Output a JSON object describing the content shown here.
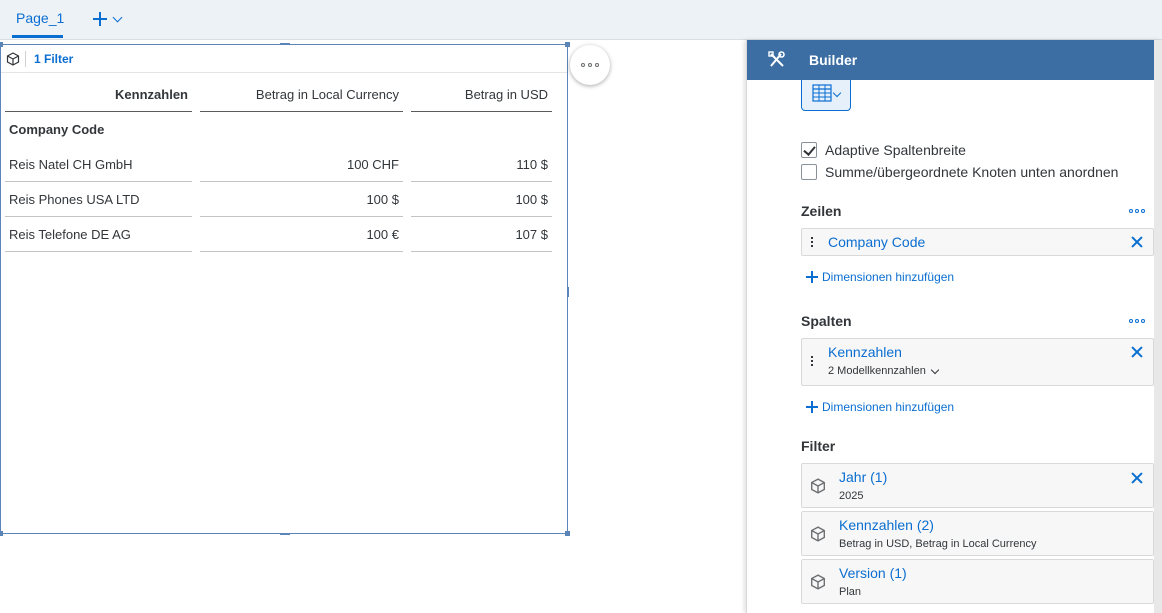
{
  "tabbar": {
    "page_tab": "Page_1"
  },
  "widget": {
    "filter_label": "1 Filter",
    "headers": [
      "Kennzahlen",
      "Betrag in Local Currency",
      "Betrag in USD"
    ],
    "group_label": "Company Code",
    "rows": [
      {
        "label": "Reis Natel CH GmbH",
        "local": "100 CHF",
        "usd": "110 $"
      },
      {
        "label": "Reis Phones USA LTD",
        "local": "100 $",
        "usd": "100 $"
      },
      {
        "label": "Reis Telefone DE AG",
        "local": "100 €",
        "usd": "107 $"
      }
    ]
  },
  "builder": {
    "title": "Builder",
    "options": {
      "adaptive": "Adaptive Spaltenbreite",
      "adaptive_checked": true,
      "sum_bottom": "Summe/übergeordnete Knoten unten anordnen",
      "sum_bottom_checked": false
    },
    "rows_section": {
      "title": "Zeilen",
      "token": "Company Code",
      "add_label": "Dimensionen hinzufügen"
    },
    "columns_section": {
      "title": "Spalten",
      "token": "Kennzahlen",
      "token_sub": "2 Modellkennzahlen",
      "add_label": "Dimensionen hinzufügen"
    },
    "filter_section": {
      "title": "Filter",
      "items": [
        {
          "title": "Jahr (1)",
          "sub": "2025"
        },
        {
          "title": "Kennzahlen (2)",
          "sub": "Betrag in USD, Betrag in Local Currency"
        },
        {
          "title": "Version (1)",
          "sub": "Plan"
        }
      ]
    }
  },
  "colors": {
    "accent": "#0a6ed1",
    "header_bar": "#3c6ea3",
    "selection_border": "#5b85b8"
  }
}
